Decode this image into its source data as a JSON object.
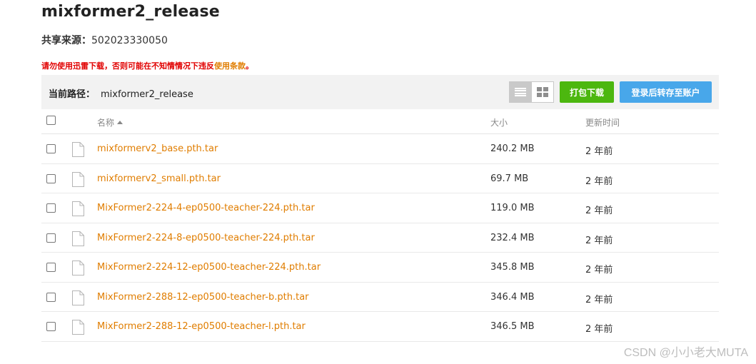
{
  "title": "mixformer2_release",
  "share": {
    "label": "共享来源：",
    "value": "502023330050"
  },
  "warning": {
    "text": "请勿使用迅雷下载，否则可能在不知情情况下违反",
    "link": "使用条款",
    "suffix": "。"
  },
  "path": {
    "label": "当前路径：",
    "value": "mixformer2_release"
  },
  "view_toggle": {
    "list_icon": "list-icon",
    "grid_icon": "grid-icon",
    "active": "list"
  },
  "buttons": {
    "pack": "打包下载",
    "login": "登录后转存至账户"
  },
  "columns": {
    "name": "名称",
    "size": "大小",
    "time": "更新时间"
  },
  "files": [
    {
      "name": "mixformerv2_base.pth.tar",
      "size": "240.2 MB",
      "time": "2 年前"
    },
    {
      "name": "mixformerv2_small.pth.tar",
      "size": "69.7 MB",
      "time": "2 年前"
    },
    {
      "name": "MixFormer2-224-4-ep0500-teacher-224.pth.tar",
      "size": "119.0 MB",
      "time": "2 年前"
    },
    {
      "name": "MixFormer2-224-8-ep0500-teacher-224.pth.tar",
      "size": "232.4 MB",
      "time": "2 年前"
    },
    {
      "name": "MixFormer2-224-12-ep0500-teacher-224.pth.tar",
      "size": "345.8 MB",
      "time": "2 年前"
    },
    {
      "name": "MixFormer2-288-12-ep0500-teacher-b.pth.tar",
      "size": "346.4 MB",
      "time": "2 年前"
    },
    {
      "name": "MixFormer2-288-12-ep0500-teacher-l.pth.tar",
      "size": "346.5 MB",
      "time": "2 年前"
    }
  ],
  "watermark": "CSDN @小小老大MUTA",
  "colors": {
    "accent_link": "#e07d00",
    "warning": "#e10000",
    "pack_button": "#4cb70f",
    "login_button": "#48a7ea"
  }
}
